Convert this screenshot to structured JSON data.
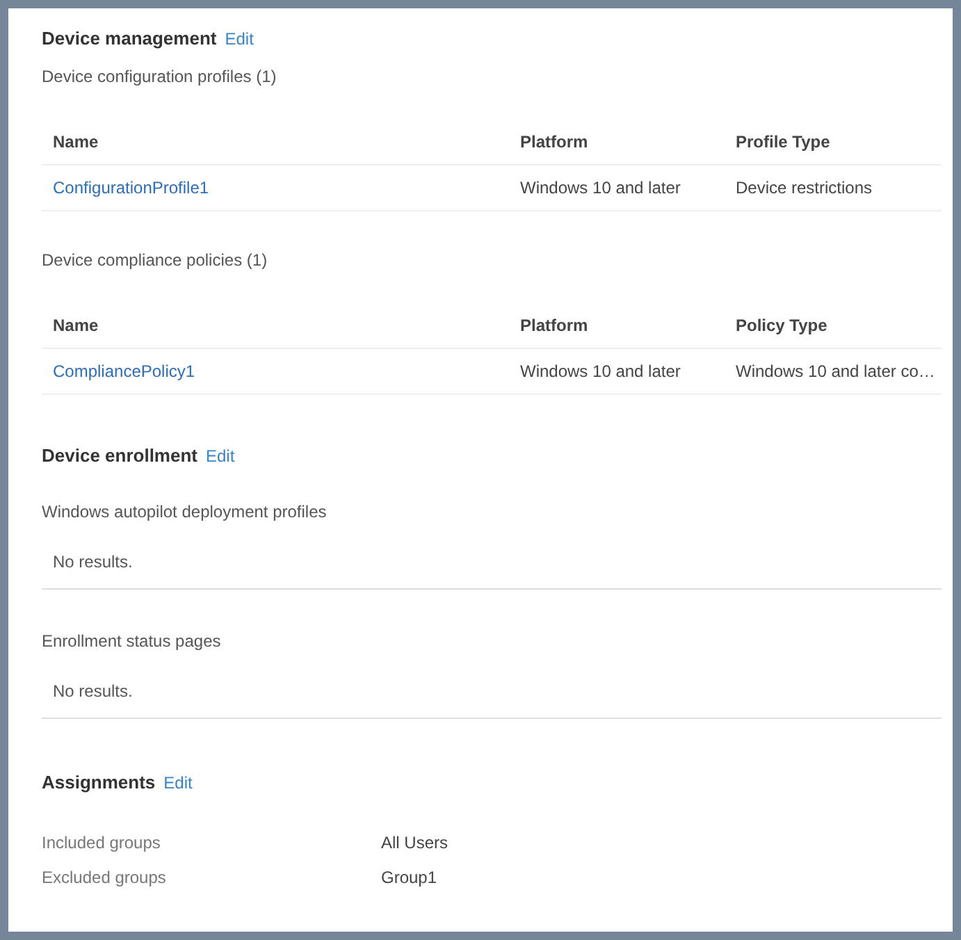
{
  "device_management": {
    "title": "Device management",
    "edit": "Edit",
    "tables": [
      {
        "caption": "Device configuration profiles (1)",
        "columns": [
          "Name",
          "Platform",
          "Profile Type"
        ],
        "rows": [
          [
            "ConfigurationProfile1",
            "Windows 10 and later",
            "Device restrictions"
          ]
        ]
      },
      {
        "caption": "Device compliance policies (1)",
        "columns": [
          "Name",
          "Platform",
          "Policy Type"
        ],
        "rows": [
          [
            "CompliancePolicy1",
            "Windows 10 and later",
            "Windows 10 and later co…"
          ]
        ]
      }
    ]
  },
  "device_enrollment": {
    "title": "Device enrollment",
    "edit": "Edit",
    "sections": [
      {
        "caption": "Windows autopilot deployment profiles",
        "empty": "No results."
      },
      {
        "caption": "Enrollment status pages",
        "empty": "No results."
      }
    ]
  },
  "assignments": {
    "title": "Assignments",
    "edit": "Edit",
    "rows": [
      {
        "label": "Included groups",
        "value": "All Users"
      },
      {
        "label": "Excluded groups",
        "value": "Group1"
      }
    ]
  }
}
